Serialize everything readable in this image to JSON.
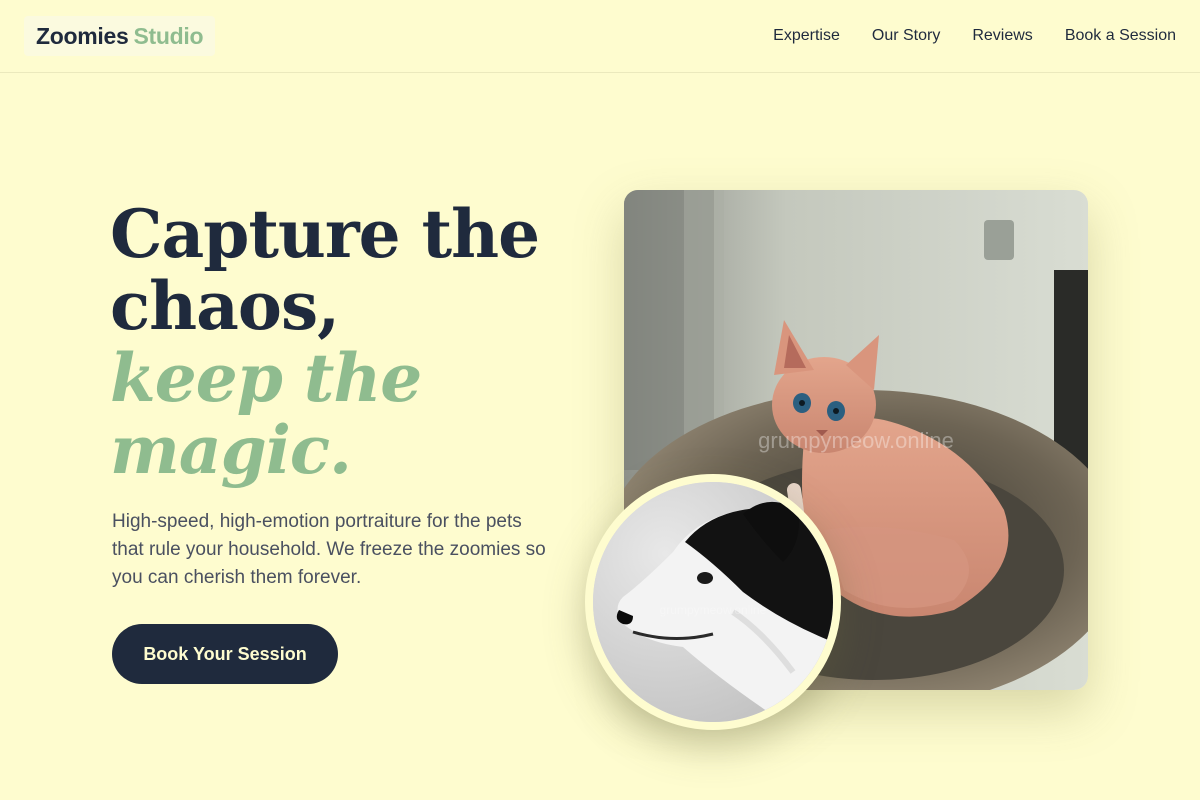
{
  "header": {
    "logo_brand": "Zoomies",
    "logo_accent": "Studio",
    "nav": [
      {
        "label": "Expertise"
      },
      {
        "label": "Our Story"
      },
      {
        "label": "Reviews"
      },
      {
        "label": "Book a Session"
      }
    ]
  },
  "hero": {
    "title_line1": "Capture the",
    "title_line2": "chaos,",
    "title_accent_line1": "keep the",
    "title_accent_line2": "magic.",
    "description": "High-speed, high-emotion portraiture for the pets that rule your household. We freeze the zoomies so you can cherish them forever.",
    "cta_label": "Book Your Session"
  },
  "images": {
    "main_photo_watermark": "grumpymeow.online",
    "circle_photo_watermark": "grumpymeow.online"
  },
  "colors": {
    "background": "#fefccf",
    "navy": "#1f2a3d",
    "sage": "#8fbc8f"
  }
}
